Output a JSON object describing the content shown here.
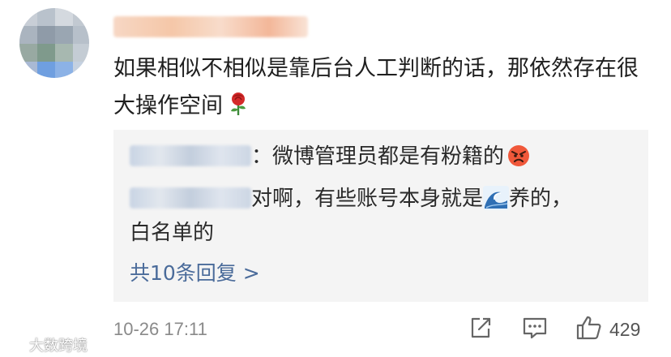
{
  "comment": {
    "text": "如果相似不相似是靠后台人工判断的话，那依然存在很大操作空间",
    "emoji": "rose-icon"
  },
  "replies": [
    {
      "text": "：微博管理员都是有粉籍的",
      "emoji": "angry-face-icon"
    },
    {
      "text_before": "对啊，有些账号本身就是",
      "emoji": "wave-icon",
      "text_after": "养的，",
      "text_line2": "白名单的"
    }
  ],
  "more_replies_label": "共10条回复 >",
  "footer": {
    "timestamp": "10-26 17:11",
    "like_count": "429"
  },
  "watermark": "大数跨境",
  "colors": {
    "link": "#4a6b9a",
    "reply_bg": "#f4f4f4",
    "text": "#1f1f1f",
    "meta": "#8a8a8a"
  }
}
